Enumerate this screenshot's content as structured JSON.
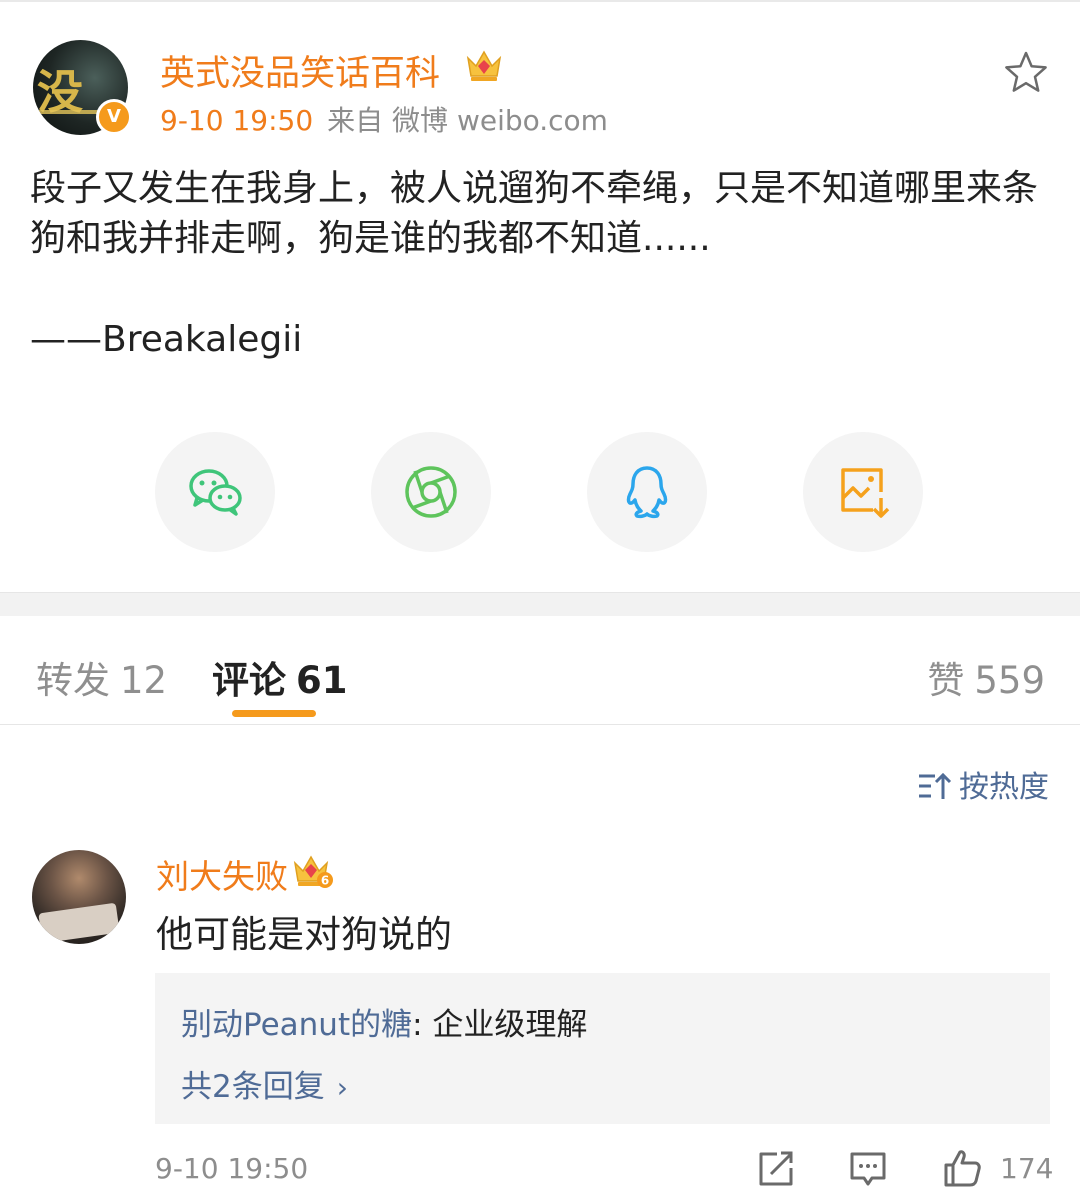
{
  "post": {
    "username": "英式没品笑话百科",
    "time": "9-10 19:50",
    "source": "来自 微博 weibo.com",
    "verified_badge": "V",
    "avatar_text": "没",
    "text": "段子又发生在我身上，被人说遛狗不牵绳，只是不知道哪里来条狗和我并排走啊，狗是谁的我都不知道......",
    "signature": "——Breakalegii"
  },
  "share": [
    {
      "icon": "wechat-icon",
      "color": "#3fc57a"
    },
    {
      "icon": "moments-icon",
      "color": "#5ec45c"
    },
    {
      "icon": "qq-icon",
      "color": "#2ba6ec"
    },
    {
      "icon": "save-image-icon",
      "color": "#f5a11c"
    }
  ],
  "tabs": {
    "repost_label": "转发",
    "repost_count": "12",
    "comments_label": "评论",
    "comments_count": "61",
    "likes_label": "赞",
    "likes_count": "559"
  },
  "sort_label": "按热度",
  "comment": {
    "username": "刘大失败",
    "member_level": "6",
    "text": "他可能是对狗说的",
    "reply": {
      "name": "别动Peanut的糖",
      "text": ": 企业级理解",
      "more": "共2条回复",
      "chevron": "›"
    },
    "time": "9-10 19:50",
    "like_count": "174"
  },
  "colors": {
    "accent_orange": "#f07c1b",
    "link_blue": "#4f6b96",
    "muted": "#8d8d8d"
  }
}
